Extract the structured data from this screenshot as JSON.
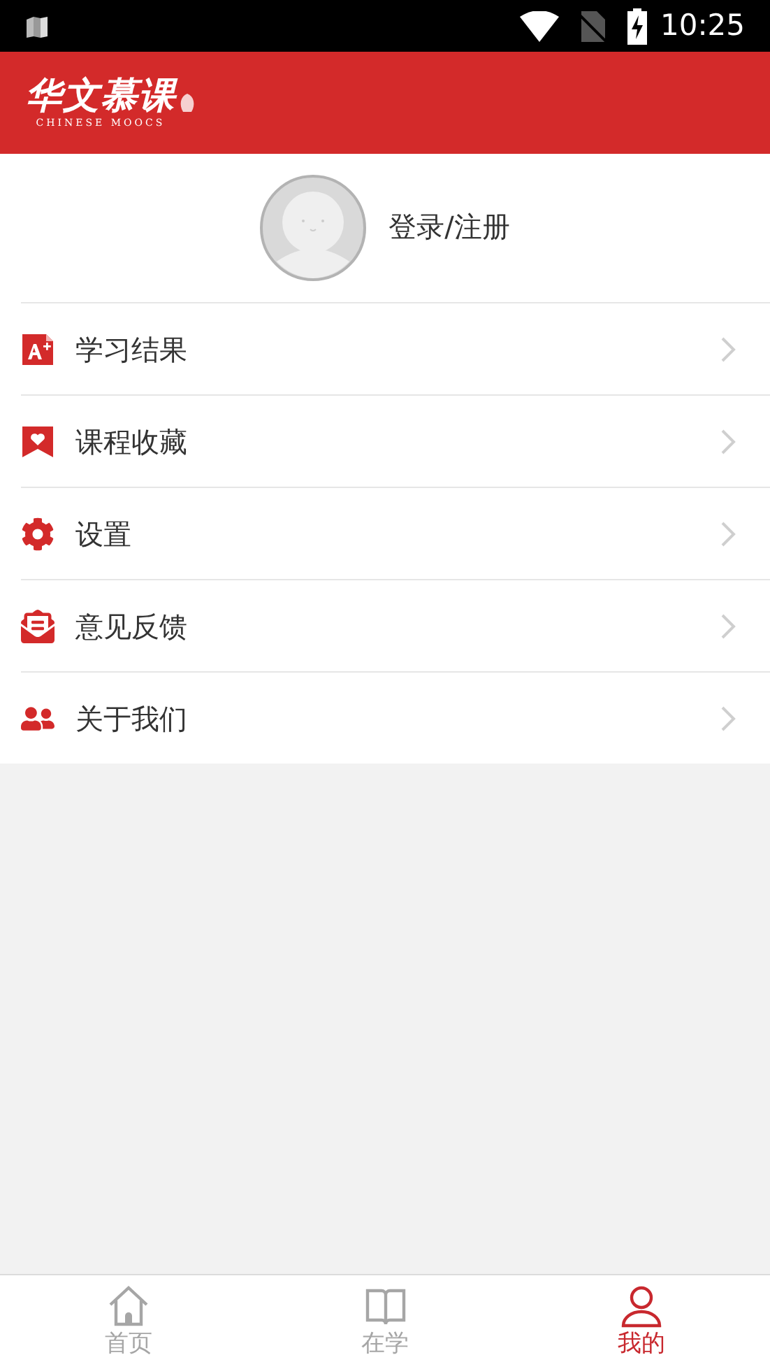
{
  "status_bar": {
    "time": "10:25"
  },
  "header": {
    "logo_title": "华文慕课",
    "logo_subtitle": "CHINESE MOOCS"
  },
  "profile": {
    "label": "登录/注册"
  },
  "menu": [
    {
      "kind": "grade",
      "label": "学习结果"
    },
    {
      "kind": "favorite",
      "label": "课程收藏"
    },
    {
      "kind": "settings",
      "label": "设置"
    },
    {
      "kind": "feedback",
      "label": "意见反馈"
    },
    {
      "kind": "about",
      "label": "关于我们"
    }
  ],
  "tabs": [
    {
      "kind": "home",
      "label": "首页",
      "selected": false
    },
    {
      "kind": "study",
      "label": "在学",
      "selected": false
    },
    {
      "kind": "me",
      "label": "我的",
      "selected": true
    }
  ]
}
